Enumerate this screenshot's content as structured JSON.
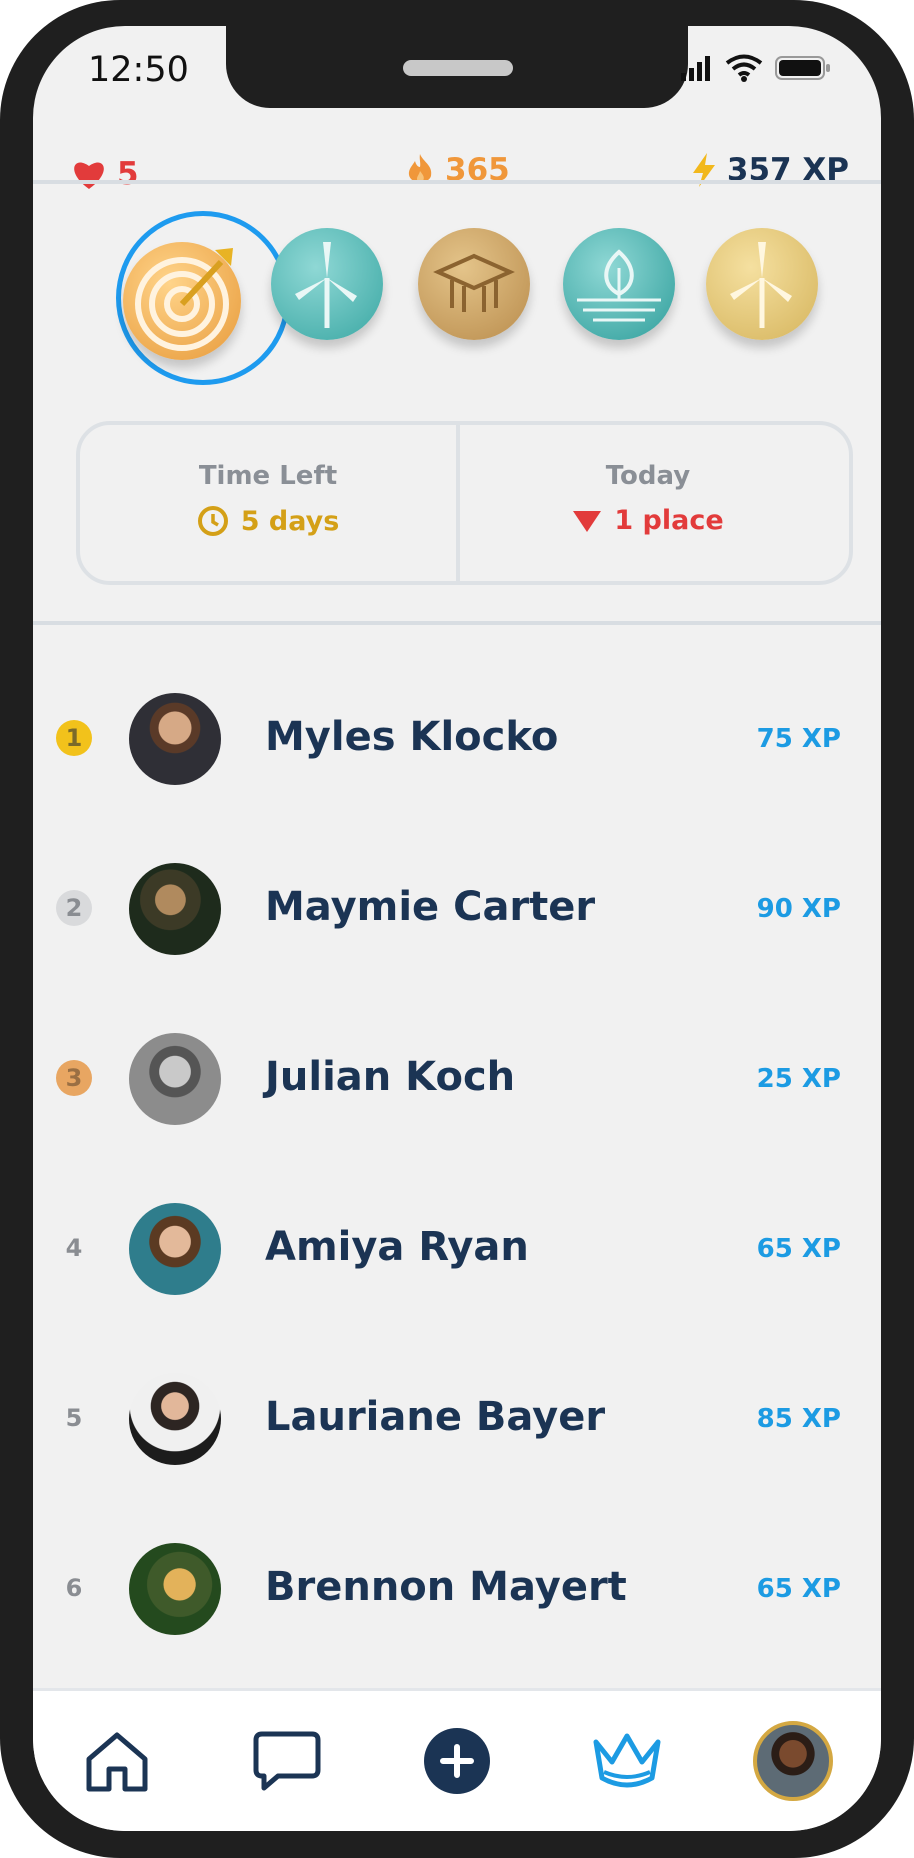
{
  "status_bar": {
    "time": "12:50"
  },
  "header": {
    "hearts": "5",
    "streak": "365",
    "xp": "357 XP"
  },
  "badges": [
    {
      "name": "target-badge",
      "selected": true
    },
    {
      "name": "wind-turbine-teal-badge"
    },
    {
      "name": "graduation-cap-bronze-badge"
    },
    {
      "name": "leaf-teal-badge"
    },
    {
      "name": "wind-turbine-gold-badge"
    }
  ],
  "info": {
    "time_left_label": "Time Left",
    "time_left_value": "5 days",
    "today_label": "Today",
    "today_value": "1 place"
  },
  "leaderboard": [
    {
      "rank": "1",
      "name": "Myles Klocko",
      "xp": "75 XP"
    },
    {
      "rank": "2",
      "name": "Maymie Carter",
      "xp": "90 XP"
    },
    {
      "rank": "3",
      "name": "Julian Koch",
      "xp": "25 XP"
    },
    {
      "rank": "4",
      "name": "Amiya Ryan",
      "xp": "65 XP"
    },
    {
      "rank": "5",
      "name": "Lauriane Bayer",
      "xp": "85 XP"
    },
    {
      "rank": "6",
      "name": "Brennon Mayert",
      "xp": "65 XP"
    }
  ],
  "colors": {
    "accent": "#1c9be3",
    "navy": "#1b3454",
    "heart": "#e23b3b",
    "streak": "#f0973a",
    "gold": "#d4a017"
  },
  "tabs": [
    {
      "icon": "home-icon"
    },
    {
      "icon": "chat-icon"
    },
    {
      "icon": "add-icon"
    },
    {
      "icon": "crown-icon",
      "active": true
    },
    {
      "icon": "profile-avatar"
    }
  ]
}
